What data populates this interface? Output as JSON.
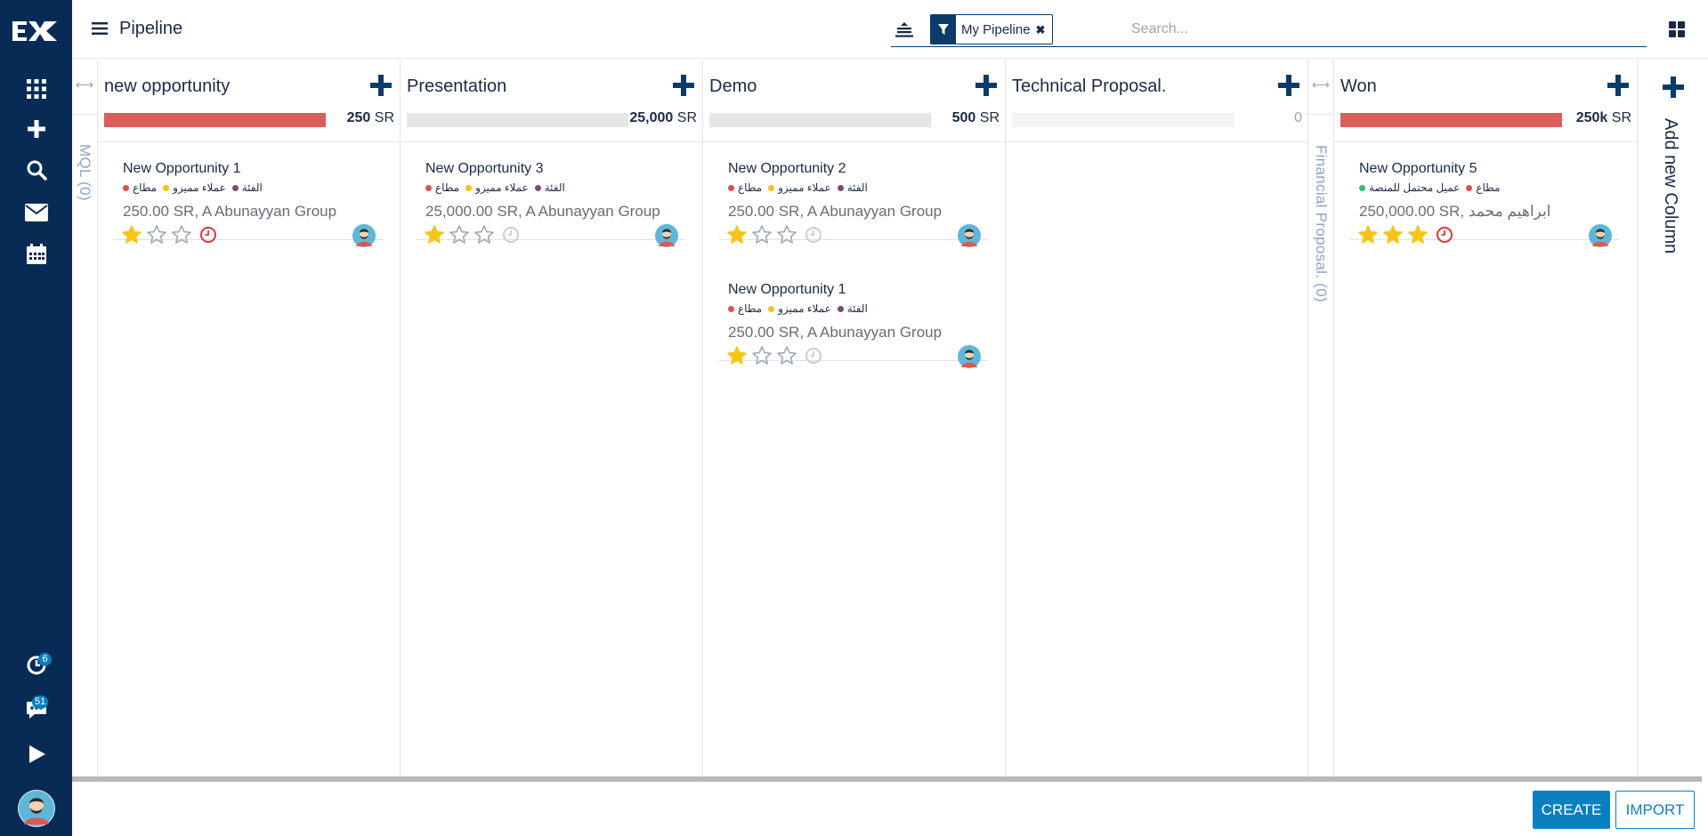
{
  "header": {
    "title": "Pipeline",
    "filter_facet": "My Pipeline",
    "filter_remove": "✖",
    "search_placeholder": "Search..."
  },
  "sidebar": {
    "badges": {
      "activities": "6",
      "messages": "51"
    }
  },
  "folded_columns": {
    "mql": "MQL (0)",
    "financial": "Financial Proposal. (0)"
  },
  "columns": [
    {
      "title": "new opportunity",
      "amount": "250",
      "currency": "SR",
      "progress_pct": 100,
      "progress_color": "#d9605a",
      "cards": [
        {
          "title": "New Opportunity 1",
          "tags": [
            "مطاع",
            "عملاء مميزو",
            "الفئة"
          ],
          "tag_colors": [
            "#e0504a",
            "#f2c11b",
            "#7b4a72"
          ],
          "subtitle": "250.00 SR, A Abunayyan Group",
          "stars": 1,
          "activity": "overdue"
        }
      ]
    },
    {
      "title": "Presentation",
      "amount": "25,000",
      "currency": "SR",
      "progress_pct": 0,
      "progress_color": "#d9605a",
      "cards": [
        {
          "title": "New Opportunity 3",
          "tags": [
            "مطاع",
            "عملاء مميزو",
            "الفئة"
          ],
          "tag_colors": [
            "#e0504a",
            "#f2c11b",
            "#7b4a72"
          ],
          "subtitle": "25,000.00 SR, A Abunayyan Group",
          "stars": 1,
          "activity": "none"
        }
      ]
    },
    {
      "title": "Demo",
      "amount": "500",
      "currency": "SR",
      "progress_pct": 0,
      "progress_color": "#d9605a",
      "cards": [
        {
          "title": "New Opportunity 2",
          "tags": [
            "مطاع",
            "عملاء مميزو",
            "الفئة"
          ],
          "tag_colors": [
            "#e0504a",
            "#f2c11b",
            "#7b4a72"
          ],
          "subtitle": "250.00 SR, A Abunayyan Group",
          "stars": 1,
          "activity": "none"
        },
        {
          "title": "New Opportunity 1",
          "tags": [
            "مطاع",
            "عملاء مميزو",
            "الفئة"
          ],
          "tag_colors": [
            "#e0504a",
            "#f2c11b",
            "#7b4a72"
          ],
          "subtitle": "250.00 SR, A Abunayyan Group",
          "stars": 1,
          "activity": "none"
        }
      ]
    },
    {
      "title": "Technical Proposal.",
      "amount": "0",
      "currency": "",
      "progress_pct": 0,
      "progress_color": "#d9605a",
      "cards": []
    },
    {
      "title": "Won",
      "amount": "250k",
      "currency": "SR",
      "progress_pct": 100,
      "progress_color": "#d9605a",
      "cards": [
        {
          "title": "New Opportunity 5",
          "tags": [
            "عميل محتمل للمنصة",
            "مطاع"
          ],
          "tag_colors": [
            "#2fbf71",
            "#e0504a"
          ],
          "subtitle": "250,000.00 SR, ابراهيم محمد",
          "stars": 3,
          "activity": "overdue"
        }
      ]
    }
  ],
  "add_column_label": "Add new Column",
  "footer": {
    "create": "CREATE",
    "import": "IMPORT"
  },
  "colors": {
    "brand": "#082b55",
    "accent": "#0a7fbf",
    "star": "#f5c518",
    "overdue": "#d9363e"
  }
}
